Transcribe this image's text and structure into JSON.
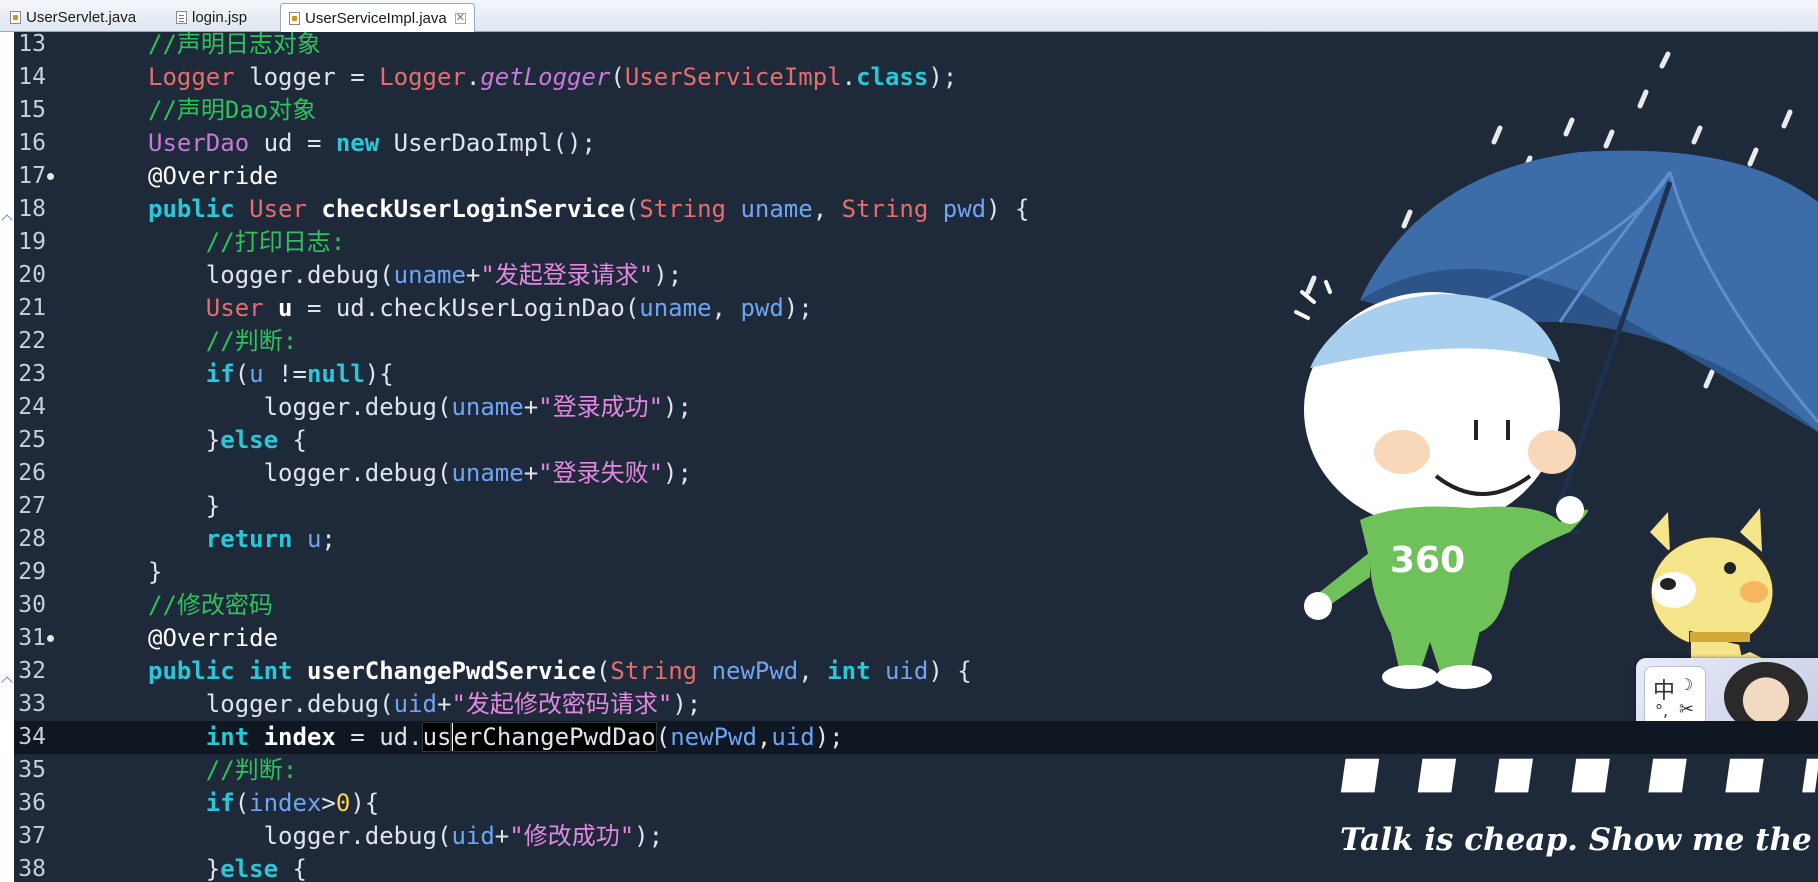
{
  "tabs": [
    {
      "label": "UserServlet.java",
      "icon": "java-file-icon",
      "active": false
    },
    {
      "label": "login.jsp",
      "icon": "jsp-file-icon",
      "active": false
    },
    {
      "label": "UserServiceImpl.java",
      "icon": "java-file-icon",
      "active": true,
      "close": "✕"
    }
  ],
  "lines": [
    {
      "n": "13",
      "tokens": [
        [
          "cm",
          "//声明日志对象"
        ]
      ]
    },
    {
      "n": "14",
      "tokens": [
        [
          "ty",
          "Logger"
        ],
        [
          "pl",
          " logger = "
        ],
        [
          "ty",
          "Logger"
        ],
        [
          "pl",
          "."
        ],
        [
          "it",
          "getLogger"
        ],
        [
          "pl",
          "("
        ],
        [
          "ty",
          "UserServiceImpl"
        ],
        [
          "pl",
          "."
        ],
        [
          "kw",
          "class"
        ],
        [
          "pl",
          ");"
        ]
      ]
    },
    {
      "n": "15",
      "tokens": [
        [
          "cm",
          "//声明Dao对象"
        ]
      ]
    },
    {
      "n": "16",
      "tokens": [
        [
          "pu",
          "UserDao"
        ],
        [
          "pl",
          " ud = "
        ],
        [
          "kw",
          "new"
        ],
        [
          "pl",
          " UserDaoImpl();"
        ]
      ]
    },
    {
      "n": "17",
      "marker": true,
      "tokens": [
        [
          "an",
          "@Override"
        ]
      ]
    },
    {
      "n": "18",
      "tokens": [
        [
          "kw",
          "public"
        ],
        [
          "pl",
          " "
        ],
        [
          "ty",
          "User"
        ],
        [
          "pl",
          " "
        ],
        [
          "fn",
          "checkUserLoginService"
        ],
        [
          "pl",
          "("
        ],
        [
          "ty",
          "String"
        ],
        [
          "pl",
          " "
        ],
        [
          "va",
          "uname"
        ],
        [
          "pl",
          ", "
        ],
        [
          "ty",
          "String"
        ],
        [
          "pl",
          " "
        ],
        [
          "va",
          "pwd"
        ],
        [
          "pl",
          ") {"
        ]
      ]
    },
    {
      "n": "19",
      "tokens": [
        [
          "pl",
          "    "
        ],
        [
          "cm",
          "//打印日志:"
        ]
      ]
    },
    {
      "n": "20",
      "tokens": [
        [
          "pl",
          "    logger.debug("
        ],
        [
          "va",
          "uname"
        ],
        [
          "pl",
          "+"
        ],
        [
          "st",
          "\"发起登录请求\""
        ],
        [
          "pl",
          ");"
        ]
      ]
    },
    {
      "n": "21",
      "tokens": [
        [
          "pl",
          "    "
        ],
        [
          "ty",
          "User"
        ],
        [
          "pl",
          " "
        ],
        [
          "fn",
          "u"
        ],
        [
          "pl",
          " = ud.checkUserLoginDao("
        ],
        [
          "va",
          "uname"
        ],
        [
          "pl",
          ", "
        ],
        [
          "va",
          "pwd"
        ],
        [
          "pl",
          ");"
        ]
      ]
    },
    {
      "n": "22",
      "tokens": [
        [
          "pl",
          "    "
        ],
        [
          "cm",
          "//判断:"
        ]
      ]
    },
    {
      "n": "23",
      "tokens": [
        [
          "pl",
          "    "
        ],
        [
          "kw",
          "if"
        ],
        [
          "pl",
          "("
        ],
        [
          "va",
          "u"
        ],
        [
          "pl",
          " !="
        ],
        [
          "kw",
          "null"
        ],
        [
          "pl",
          "){"
        ]
      ]
    },
    {
      "n": "24",
      "tokens": [
        [
          "pl",
          "        logger.debug("
        ],
        [
          "va",
          "uname"
        ],
        [
          "pl",
          "+"
        ],
        [
          "st",
          "\"登录成功\""
        ],
        [
          "pl",
          ");"
        ]
      ]
    },
    {
      "n": "25",
      "tokens": [
        [
          "pl",
          "    }"
        ],
        [
          "kw",
          "else"
        ],
        [
          "pl",
          " {"
        ]
      ]
    },
    {
      "n": "26",
      "tokens": [
        [
          "pl",
          "        logger.debug("
        ],
        [
          "va",
          "uname"
        ],
        [
          "pl",
          "+"
        ],
        [
          "st",
          "\"登录失败\""
        ],
        [
          "pl",
          ");"
        ]
      ]
    },
    {
      "n": "27",
      "tokens": [
        [
          "pl",
          "    }"
        ]
      ]
    },
    {
      "n": "28",
      "tokens": [
        [
          "pl",
          "    "
        ],
        [
          "kw",
          "return"
        ],
        [
          "pl",
          " "
        ],
        [
          "va",
          "u"
        ],
        [
          "pl",
          ";"
        ]
      ]
    },
    {
      "n": "29",
      "tokens": [
        [
          "pl",
          "}"
        ]
      ]
    },
    {
      "n": "30",
      "tokens": [
        [
          "cm",
          "//修改密码"
        ]
      ]
    },
    {
      "n": "31",
      "marker": true,
      "tokens": [
        [
          "an",
          "@Override"
        ]
      ]
    },
    {
      "n": "32",
      "tokens": [
        [
          "kw",
          "public"
        ],
        [
          "pl",
          " "
        ],
        [
          "kw",
          "int"
        ],
        [
          "pl",
          " "
        ],
        [
          "fn",
          "userChangePwdService"
        ],
        [
          "pl",
          "("
        ],
        [
          "ty",
          "String"
        ],
        [
          "pl",
          " "
        ],
        [
          "va",
          "newPwd"
        ],
        [
          "pl",
          ", "
        ],
        [
          "kw",
          "int"
        ],
        [
          "pl",
          " "
        ],
        [
          "va",
          "uid"
        ],
        [
          "pl",
          ") {"
        ]
      ]
    },
    {
      "n": "33",
      "tokens": [
        [
          "pl",
          "    logger.debug("
        ],
        [
          "va",
          "uid"
        ],
        [
          "pl",
          "+"
        ],
        [
          "st",
          "\"发起修改密码请求\""
        ],
        [
          "pl",
          ");"
        ]
      ]
    },
    {
      "n": "34",
      "current": true,
      "tokens": [
        [
          "pl",
          "    "
        ],
        [
          "kw",
          "int"
        ],
        [
          "pl",
          " "
        ],
        [
          "fn",
          "index"
        ],
        [
          "pl",
          " = ud."
        ],
        [
          "sel",
          "us"
        ],
        [
          "selc",
          "erChangePwdDao"
        ],
        [
          "pl",
          "("
        ],
        [
          "va",
          "newPwd"
        ],
        [
          "pl",
          ","
        ],
        [
          "va",
          "uid"
        ],
        [
          "pl",
          ");"
        ]
      ]
    },
    {
      "n": "35",
      "tokens": [
        [
          "pl",
          "    "
        ],
        [
          "cm",
          "//判断:"
        ]
      ]
    },
    {
      "n": "36",
      "tokens": [
        [
          "pl",
          "    "
        ],
        [
          "kw",
          "if"
        ],
        [
          "pl",
          "("
        ],
        [
          "va",
          "index"
        ],
        [
          "pl",
          ">"
        ],
        [
          "nu",
          "0"
        ],
        [
          "pl",
          "){"
        ]
      ]
    },
    {
      "n": "37",
      "tokens": [
        [
          "pl",
          "        logger.debug("
        ],
        [
          "va",
          "uid"
        ],
        [
          "pl",
          "+"
        ],
        [
          "st",
          "\"修改成功\""
        ],
        [
          "pl",
          ");"
        ]
      ]
    },
    {
      "n": "38",
      "tokens": [
        [
          "pl",
          "    }"
        ],
        [
          "kw",
          "else"
        ],
        [
          "pl",
          " {"
        ]
      ]
    }
  ],
  "wallpaper": {
    "slogan_en": "Talk is cheap. Show me the code!",
    "shirt_text": "360"
  },
  "ime": {
    "char": "中",
    "moon": "☽",
    "punct": "°,",
    "fly": "✂"
  }
}
